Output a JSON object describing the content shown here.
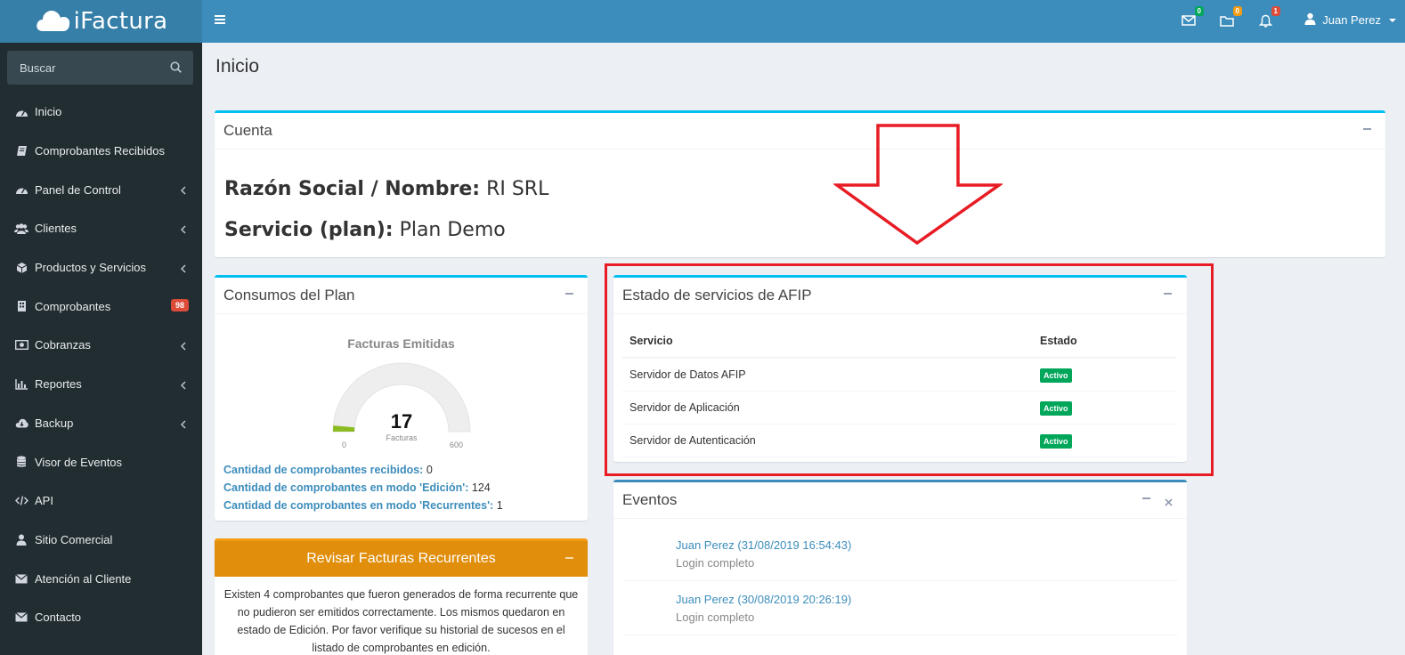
{
  "brand": {
    "name": "iFactura",
    "icon": "cloud-icon"
  },
  "topbar": {
    "menu_icon": "hamburger-icon",
    "messages": {
      "icon": "envelope-icon",
      "count": "0",
      "color": "#00a65a"
    },
    "tasks": {
      "icon": "folder-icon",
      "count": "0",
      "color": "#f39c12"
    },
    "notifications": {
      "icon": "bell-icon",
      "count": "1",
      "color": "#dd4b39"
    },
    "user": {
      "icon": "user-icon",
      "name": "Juan Perez"
    }
  },
  "sidebar": {
    "search_placeholder": "Buscar",
    "items": [
      {
        "label": "Inicio",
        "icon": "dashboard-icon",
        "has_submenu": false
      },
      {
        "label": "Comprobantes Recibidos",
        "icon": "book-icon",
        "has_submenu": false
      },
      {
        "label": "Panel de Control",
        "icon": "dashboard-icon",
        "has_submenu": true
      },
      {
        "label": "Clientes",
        "icon": "users-icon",
        "has_submenu": true
      },
      {
        "label": "Productos y Servicios",
        "icon": "cube-icon",
        "has_submenu": true
      },
      {
        "label": "Comprobantes",
        "icon": "building-icon",
        "has_submenu": false,
        "badge": "98"
      },
      {
        "label": "Cobranzas",
        "icon": "money-icon",
        "has_submenu": true
      },
      {
        "label": "Reportes",
        "icon": "bar-chart-icon",
        "has_submenu": true
      },
      {
        "label": "Backup",
        "icon": "cloud-download-icon",
        "has_submenu": true
      },
      {
        "label": "Visor de Eventos",
        "icon": "database-icon",
        "has_submenu": false
      },
      {
        "label": "API",
        "icon": "code-icon",
        "has_submenu": false
      },
      {
        "label": "Sitio Comercial",
        "icon": "user-icon",
        "has_submenu": false
      },
      {
        "label": "Atención al Cliente",
        "icon": "envelope-icon",
        "has_submenu": false
      },
      {
        "label": "Contacto",
        "icon": "envelope-icon",
        "has_submenu": false
      }
    ]
  },
  "page": {
    "title": "Inicio"
  },
  "cuenta": {
    "title": "Cuenta",
    "razon_label": "Razón Social / Nombre:",
    "razon_value": "RI SRL",
    "servicio_label": "Servicio (plan):",
    "servicio_value": "Plan Demo"
  },
  "consumos": {
    "title": "Consumos del Plan",
    "gauge": {
      "title": "Facturas Emitidas",
      "value": 17,
      "unit": "Facturas",
      "min": 0,
      "max": 600,
      "color": "#8bbc21"
    },
    "stats": [
      {
        "label": "Cantidad de comprobantes recibidos:",
        "value": "0"
      },
      {
        "label": "Cantidad de comprobantes en modo 'Edición':",
        "value": "124"
      },
      {
        "label": "Cantidad de comprobantes en modo 'Recurrentes':",
        "value": "1"
      }
    ]
  },
  "recurrentes": {
    "title": "Revisar Facturas Recurrentes",
    "body": "Existen 4 comprobantes que fueron generados de forma recurrente que no pudieron ser emitidos correctamente. Los mismos quedaron en estado de Edición. Por favor verifique su historial de sucesos en el listado de comprobantes en edición."
  },
  "afip": {
    "title": "Estado de servicios de AFIP",
    "columns": [
      "Servicio",
      "Estado"
    ],
    "rows": [
      {
        "servicio": "Servidor de Datos AFIP",
        "estado": "Activo"
      },
      {
        "servicio": "Servidor de Aplicación",
        "estado": "Activo"
      },
      {
        "servicio": "Servidor de Autenticación",
        "estado": "Activo"
      }
    ]
  },
  "eventos": {
    "title": "Eventos",
    "items": [
      {
        "user": "Juan Perez (31/08/2019 16:54:43)",
        "desc": "Login completo"
      },
      {
        "user": "Juan Perez (30/08/2019 20:26:19)",
        "desc": "Login completo"
      }
    ]
  }
}
